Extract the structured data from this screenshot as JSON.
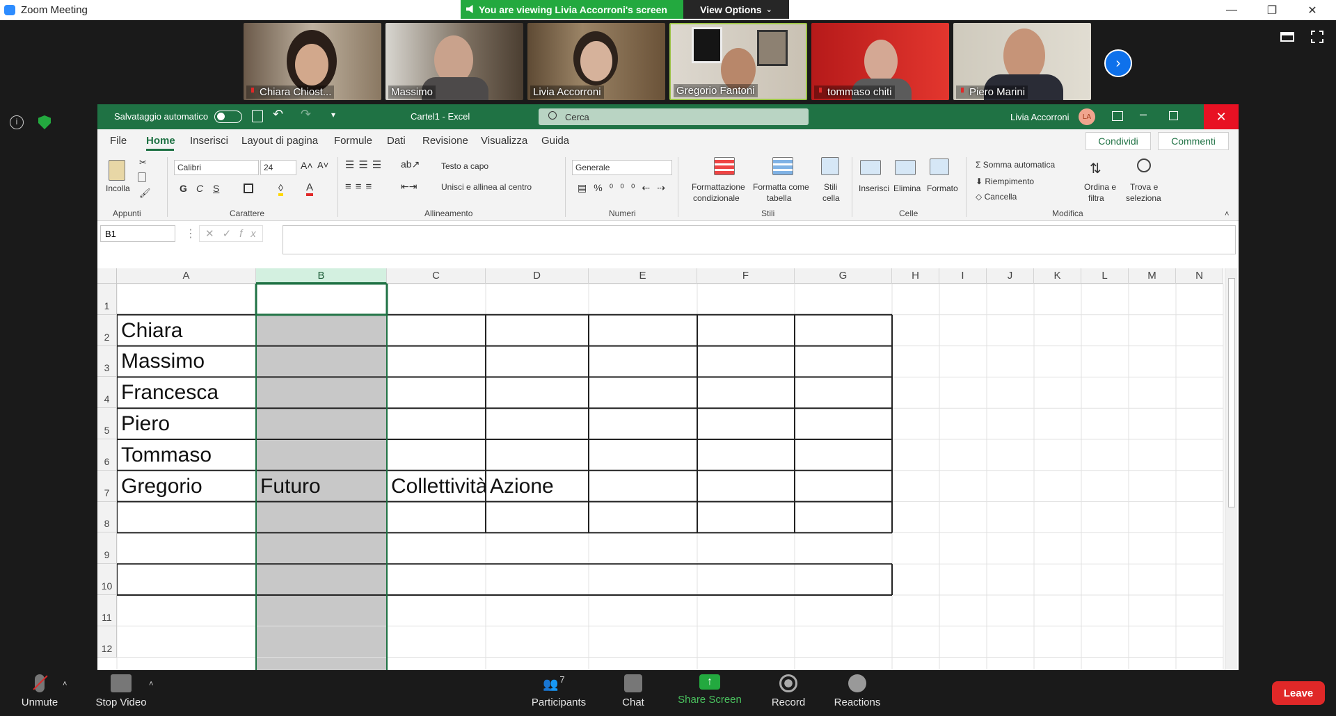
{
  "zoom": {
    "title": "Zoom Meeting",
    "banner": "You are viewing Livia Accorroni's screen",
    "view_options": "View Options",
    "win_min": "—",
    "win_restore": "❐",
    "win_close": "✕",
    "participants": [
      {
        "name": "Chiara Chiost...",
        "muted": true
      },
      {
        "name": "Massimo",
        "muted": false
      },
      {
        "name": "Livia Accorroni",
        "muted": false
      },
      {
        "name": "Gregorio Fantoni",
        "muted": false
      },
      {
        "name": "tommaso chiti",
        "muted": true
      },
      {
        "name": "Piero Marini",
        "muted": true
      }
    ],
    "toolbar": {
      "unmute": "Unmute",
      "stop_video": "Stop Video",
      "participants": "Participants",
      "participants_count": "7",
      "chat": "Chat",
      "share_screen": "Share Screen",
      "record": "Record",
      "reactions": "Reactions",
      "leave": "Leave"
    },
    "colors": {
      "accent": "#0e71eb",
      "share": "#23a93f",
      "leave": "#e02828"
    }
  },
  "excel": {
    "autosave": "Salvataggio automatico",
    "doc_title": "Cartel1  -  Excel",
    "search_placeholder": "Cerca",
    "user": "Livia Accorroni",
    "user_initials": "LA",
    "menu": [
      "File",
      "Home",
      "Inserisci",
      "Layout di pagina",
      "Formule",
      "Dati",
      "Revisione",
      "Visualizza",
      "Guida"
    ],
    "share": "Condividi",
    "comments": "Commenti",
    "ribbon": {
      "paste": "Incolla",
      "font_name": "Calibri",
      "font_size": "24",
      "bold": "G",
      "italic": "C",
      "underline": "S",
      "wrap_text": "Testo a capo",
      "merge_center": "Unisci e allinea al centro",
      "number_format": "Generale",
      "cond_format_1": "Formattazione",
      "cond_format_2": "condizionale",
      "format_table_1": "Formatta come",
      "format_table_2": "tabella",
      "cell_styles_1": "Stili",
      "cell_styles_2": "cella",
      "insert": "Inserisci",
      "delete": "Elimina",
      "format": "Formato",
      "autosum": "Somma automatica",
      "fill": "Riempimento",
      "clear": "Cancella",
      "sort_1": "Ordina e",
      "sort_2": "filtra",
      "find_1": "Trova e",
      "find_2": "seleziona",
      "groups": [
        "Appunti",
        "Carattere",
        "Allineamento",
        "Numeri",
        "Stili",
        "Celle",
        "Modifica"
      ]
    },
    "name_box": "B1",
    "columns": [
      "A",
      "B",
      "C",
      "D",
      "E",
      "F",
      "G",
      "H",
      "I",
      "J",
      "K",
      "L",
      "M",
      "N"
    ],
    "rows": [
      "1",
      "2",
      "3",
      "4",
      "5",
      "6",
      "7",
      "8",
      "9",
      "10",
      "11",
      "12"
    ],
    "cells": {
      "A2": "Chiara",
      "A3": "Massimo",
      "A4": "Francesca",
      "A5": "Piero",
      "A6": "Tommaso",
      "A7": "Gregorio",
      "B7": "Futuro",
      "C7": "Collettività",
      "D7": "Azione"
    }
  }
}
